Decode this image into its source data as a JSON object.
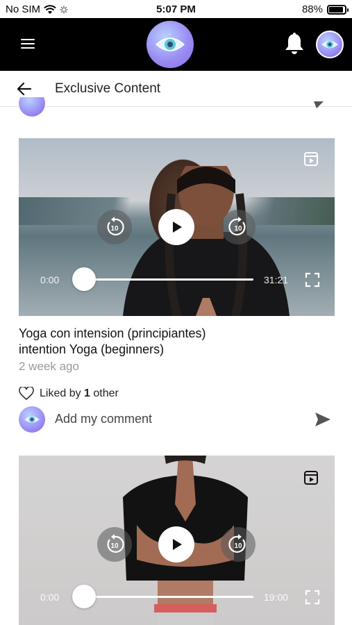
{
  "status_bar": {
    "carrier": "No SIM",
    "time": "5:07 PM",
    "battery": "88%"
  },
  "app_bar": {
    "menu_icon": "hamburger-menu-icon",
    "logo_icon": "evil-eye-logo",
    "notification_icon": "bell-icon",
    "profile_icon": "user-avatar"
  },
  "header": {
    "back_icon": "arrow-left-icon",
    "title": "Exclusive Content"
  },
  "posts": [
    {
      "video": {
        "current_time": "0:00",
        "duration": "31:21",
        "progress": 0.0,
        "rewind_label": "10",
        "forward_label": "10"
      },
      "title_line1": "Yoga con intension (principiantes)",
      "title_line2": "intention Yoga (beginners)",
      "time_ago": "2 week ago",
      "likes_prefix": "Liked by",
      "likes_count": "1",
      "likes_suffix": "other",
      "comment_placeholder": "Add my comment"
    },
    {
      "video": {
        "current_time": "0:00",
        "duration": "19:00",
        "progress": 0.0,
        "rewind_label": "10",
        "forward_label": "10"
      }
    }
  ],
  "colors": {
    "app_bar_bg": "#000000",
    "accent_avatar": "#9a8df3",
    "muted_text": "#999999"
  }
}
